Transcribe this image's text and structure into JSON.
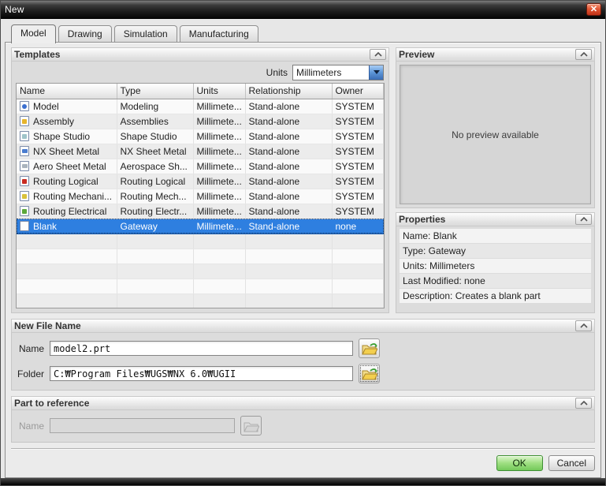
{
  "window": {
    "title": "New",
    "close_glyph": "✕"
  },
  "tabs": [
    {
      "label": "Model",
      "active": true
    },
    {
      "label": "Drawing",
      "active": false
    },
    {
      "label": "Simulation",
      "active": false
    },
    {
      "label": "Manufacturing",
      "active": false
    }
  ],
  "templates": {
    "header": "Templates",
    "units_label": "Units",
    "units_value": "Millimeters",
    "columns": [
      "Name",
      "Type",
      "Units",
      "Relationship",
      "Owner"
    ],
    "rows": [
      {
        "icon": "model-icon",
        "name": "Model",
        "type": "Modeling",
        "units": "Millimete...",
        "relationship": "Stand-alone",
        "owner": "SYSTEM",
        "selected": false
      },
      {
        "icon": "assembly-icon",
        "name": "Assembly",
        "type": "Assemblies",
        "units": "Millimete...",
        "relationship": "Stand-alone",
        "owner": "SYSTEM",
        "selected": false
      },
      {
        "icon": "shape-studio-icon",
        "name": "Shape Studio",
        "type": "Shape Studio",
        "units": "Millimete...",
        "relationship": "Stand-alone",
        "owner": "SYSTEM",
        "selected": false
      },
      {
        "icon": "nx-sheet-metal-icon",
        "name": "NX Sheet Metal",
        "type": "NX Sheet Metal",
        "units": "Millimete...",
        "relationship": "Stand-alone",
        "owner": "SYSTEM",
        "selected": false
      },
      {
        "icon": "aero-sheet-metal-icon",
        "name": "Aero Sheet Metal",
        "type": "Aerospace Sh...",
        "units": "Millimete...",
        "relationship": "Stand-alone",
        "owner": "SYSTEM",
        "selected": false
      },
      {
        "icon": "routing-logical-icon",
        "name": "Routing Logical",
        "type": "Routing Logical",
        "units": "Millimete...",
        "relationship": "Stand-alone",
        "owner": "SYSTEM",
        "selected": false
      },
      {
        "icon": "routing-mechanical-icon",
        "name": "Routing Mechani...",
        "type": "Routing Mech...",
        "units": "Millimete...",
        "relationship": "Stand-alone",
        "owner": "SYSTEM",
        "selected": false
      },
      {
        "icon": "routing-electrical-icon",
        "name": "Routing Electrical",
        "type": "Routing Electr...",
        "units": "Millimete...",
        "relationship": "Stand-alone",
        "owner": "SYSTEM",
        "selected": false
      },
      {
        "icon": "blank-icon",
        "name": "Blank",
        "type": "Gateway",
        "units": "Millimete...",
        "relationship": "Stand-alone",
        "owner": "none",
        "selected": true
      }
    ],
    "empty_row_count": 5
  },
  "preview": {
    "header": "Preview",
    "empty_text": "No preview available"
  },
  "properties": {
    "header": "Properties",
    "items": [
      "Name: Blank",
      "Type: Gateway",
      "Units: Millimeters",
      "Last Modified: none",
      "Description: Creates a blank part"
    ]
  },
  "new_file_name": {
    "header": "New File Name",
    "name_label": "Name",
    "name_value": "model2.prt",
    "folder_label": "Folder",
    "folder_value": "C:₩Program Files₩UGS₩NX 6.0₩UGII"
  },
  "part_to_reference": {
    "header": "Part to reference",
    "name_label": "Name",
    "name_value": ""
  },
  "footer": {
    "ok_label": "OK",
    "cancel_label": "Cancel"
  },
  "colors": {
    "selection": "#2e7fe0",
    "ok_green": "#74c95a",
    "titlebar": "#1c1c1c",
    "close_red": "#e25634"
  }
}
